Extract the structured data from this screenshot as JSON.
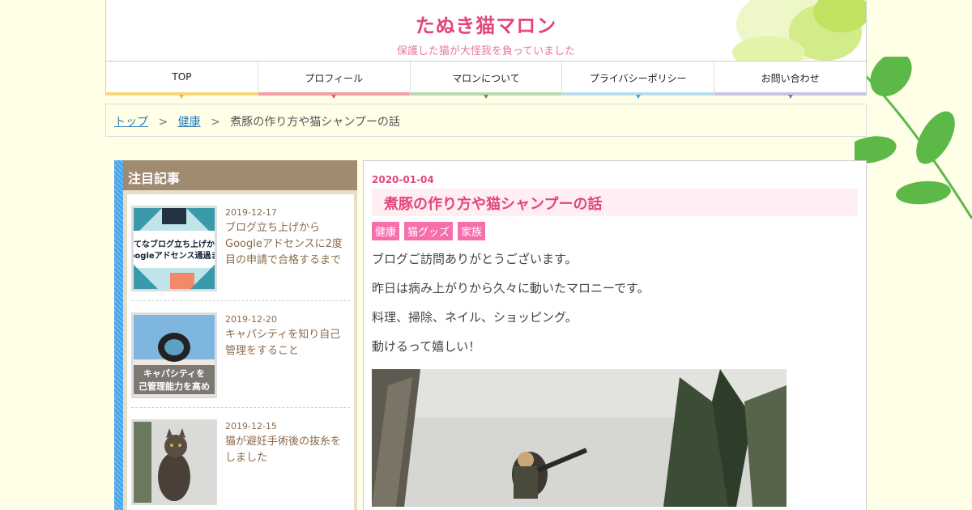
{
  "header": {
    "title": "たぬき猫マロン",
    "description": "保護した猫が大怪我を負っていました"
  },
  "nav": [
    {
      "label": "TOP",
      "color": "#f7d77a"
    },
    {
      "label": "プロフィール",
      "color": "#f2a0a4"
    },
    {
      "label": "マロンについて",
      "color": "#b9d9b0"
    },
    {
      "label": "プライバシーポリシー",
      "color": "#b8ddef"
    },
    {
      "label": "お問い合わせ",
      "color": "#c9c4e4"
    }
  ],
  "breadcrumb": {
    "home": "トップ",
    "category": "健康",
    "current": "煮豚の作り方や猫シャンプーの話",
    "separator": ">"
  },
  "sidebar": {
    "heading": "注目記事",
    "items": [
      {
        "date": "2019-12-17",
        "title": "ブログ立ち上げからGoogleアドセンスに2度目の申請で合格するまで",
        "thumb_text": "てなブログ立ち上げか\noogleアドセンス通過ま"
      },
      {
        "date": "2019-12-20",
        "title": "キャパシティを知り自己管理をすること",
        "thumb_text": "キャパシティを\n己管理能力を高め"
      },
      {
        "date": "2019-12-15",
        "title": "猫が避妊手術後の抜糸をしました"
      }
    ]
  },
  "post": {
    "date": "2020-01-04",
    "title": "煮豚の作り方や猫シャンプーの話",
    "tags": [
      "健康",
      "猫グッズ",
      "家族"
    ],
    "paragraphs": [
      "ブログご訪問ありがとうございます。",
      "昨日は病み上がりから久々に動いたマロニーです。",
      "料理、掃除、ネイル、ショッピング。",
      "動けるって嬉しい！"
    ]
  },
  "colors": {
    "accent": "#e4457e",
    "tag": "#f66fac",
    "sidebar_head": "#a08a70",
    "sidebar_stripe": "#3fa2ec",
    "leaf": "#5cb947"
  }
}
